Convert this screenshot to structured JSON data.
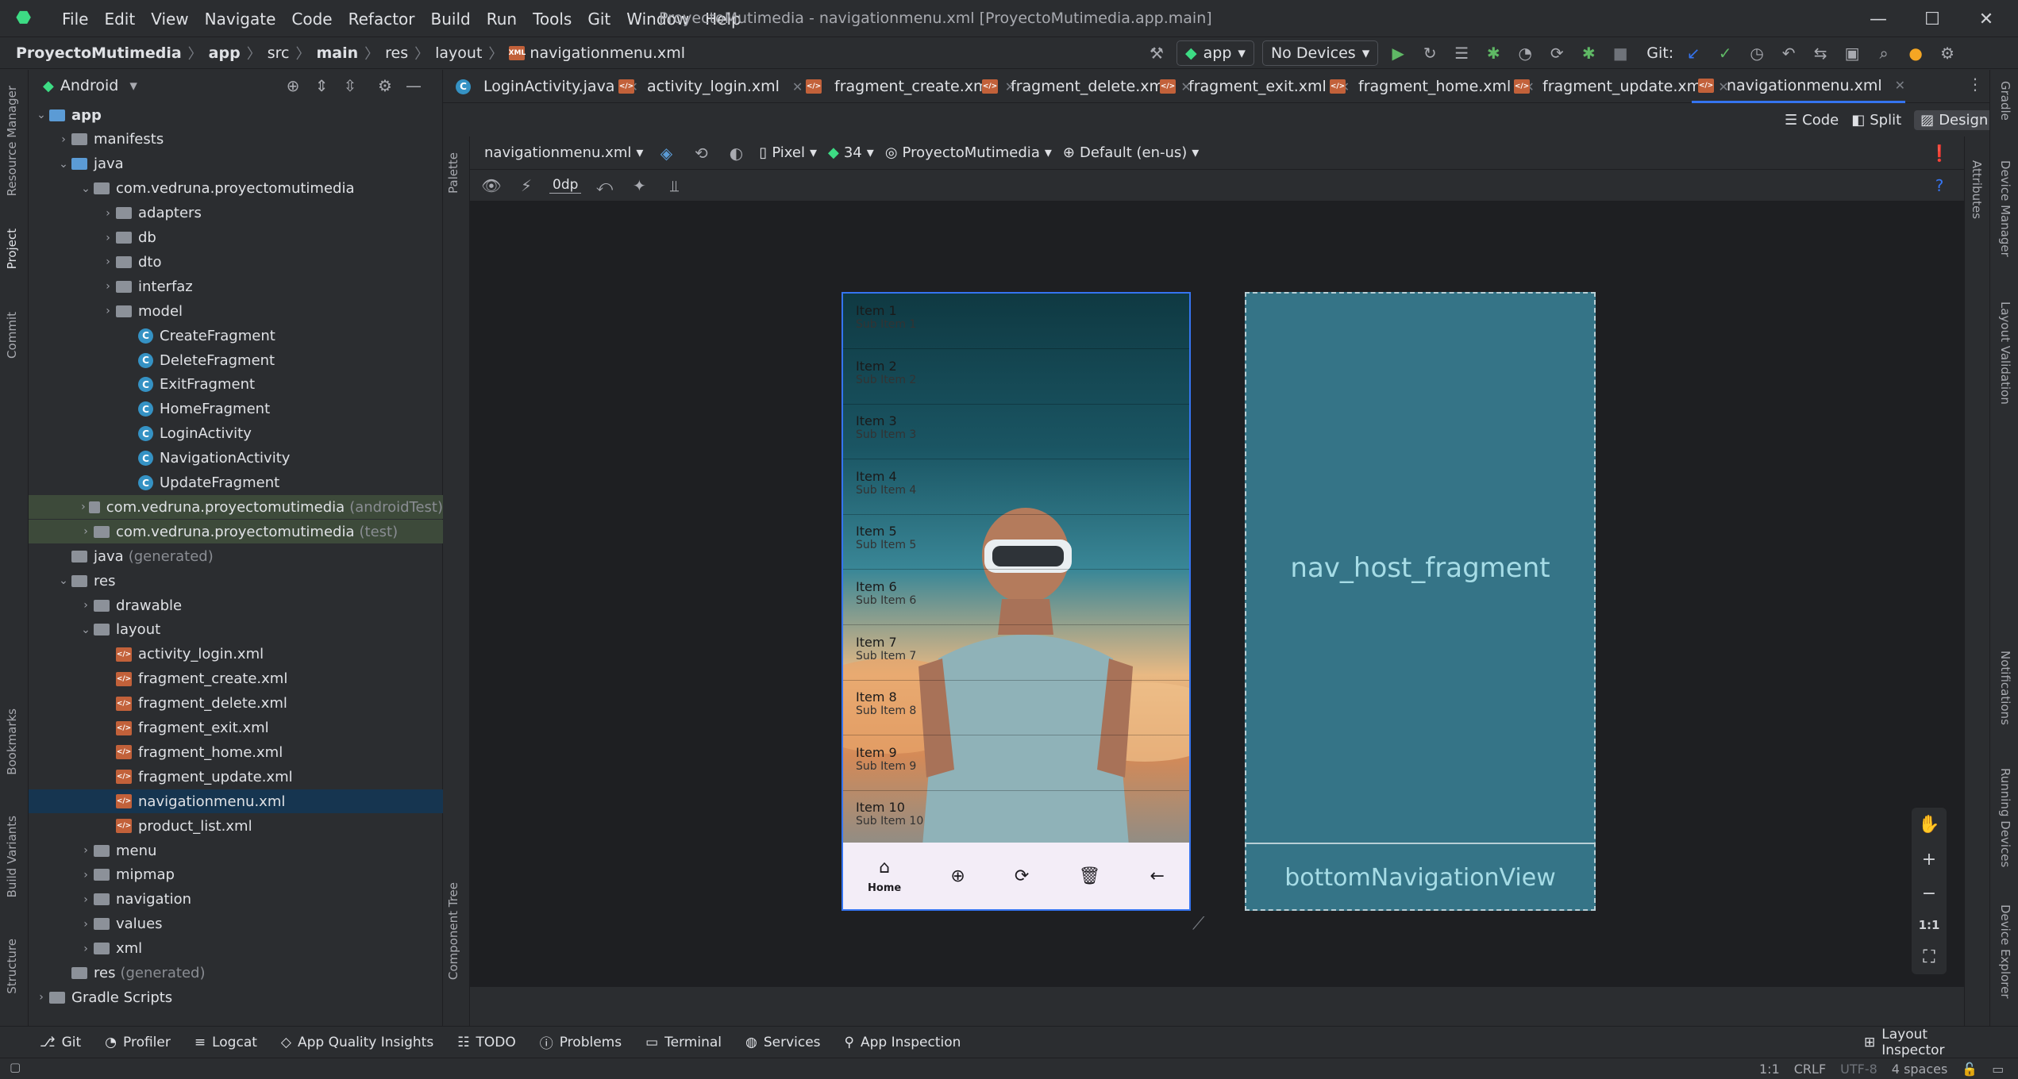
{
  "titlebar": {
    "menu": [
      "File",
      "Edit",
      "View",
      "Navigate",
      "Code",
      "Refactor",
      "Build",
      "Run",
      "Tools",
      "Git",
      "Window",
      "Help"
    ],
    "title": "ProyectoMutimedia - navigationmenu.xml [ProyectoMutimedia.app.main]"
  },
  "navbar": {
    "crumbs": [
      "ProyectoMutimedia",
      "app",
      "src",
      "main",
      "res",
      "layout",
      "navigationmenu.xml"
    ],
    "run_config": "app",
    "device": "No Devices",
    "git_label": "Git:"
  },
  "project": {
    "view_label": "Android",
    "tree": [
      {
        "label": "app",
        "level": 0,
        "icon": "module",
        "open": true,
        "bold": true
      },
      {
        "label": "manifests",
        "level": 1,
        "icon": "folder",
        "open": false
      },
      {
        "label": "java",
        "level": 1,
        "icon": "folder-blue",
        "open": true
      },
      {
        "label": "com.vedruna.proyectomutimedia",
        "level": 2,
        "icon": "package",
        "open": true
      },
      {
        "label": "adapters",
        "level": 3,
        "icon": "package",
        "open": false
      },
      {
        "label": "db",
        "level": 3,
        "icon": "package",
        "open": false
      },
      {
        "label": "dto",
        "level": 3,
        "icon": "package",
        "open": false
      },
      {
        "label": "interfaz",
        "level": 3,
        "icon": "package",
        "open": false
      },
      {
        "label": "model",
        "level": 3,
        "icon": "package",
        "open": false
      },
      {
        "label": "CreateFragment",
        "level": 4,
        "icon": "class"
      },
      {
        "label": "DeleteFragment",
        "level": 4,
        "icon": "class"
      },
      {
        "label": "ExitFragment",
        "level": 4,
        "icon": "class"
      },
      {
        "label": "HomeFragment",
        "level": 4,
        "icon": "class"
      },
      {
        "label": "LoginActivity",
        "level": 4,
        "icon": "class"
      },
      {
        "label": "NavigationActivity",
        "level": 4,
        "icon": "class"
      },
      {
        "label": "UpdateFragment",
        "level": 4,
        "icon": "class"
      },
      {
        "label": "com.vedruna.proyectomutimedia",
        "suffix": "(androidTest)",
        "level": 2,
        "icon": "package",
        "open": false,
        "hl": true
      },
      {
        "label": "com.vedruna.proyectomutimedia",
        "suffix": "(test)",
        "level": 2,
        "icon": "package",
        "open": false,
        "hl": true
      },
      {
        "label": "java",
        "suffix": "(generated)",
        "level": 1,
        "icon": "folder-gen"
      },
      {
        "label": "res",
        "level": 1,
        "icon": "folder-res",
        "open": true
      },
      {
        "label": "drawable",
        "level": 2,
        "icon": "folder",
        "open": false
      },
      {
        "label": "layout",
        "level": 2,
        "icon": "folder",
        "open": true
      },
      {
        "label": "activity_login.xml",
        "level": 3,
        "icon": "xml"
      },
      {
        "label": "fragment_create.xml",
        "level": 3,
        "icon": "xml"
      },
      {
        "label": "fragment_delete.xml",
        "level": 3,
        "icon": "xml"
      },
      {
        "label": "fragment_exit.xml",
        "level": 3,
        "icon": "xml"
      },
      {
        "label": "fragment_home.xml",
        "level": 3,
        "icon": "xml"
      },
      {
        "label": "fragment_update.xml",
        "level": 3,
        "icon": "xml"
      },
      {
        "label": "navigationmenu.xml",
        "level": 3,
        "icon": "xml",
        "selected": true
      },
      {
        "label": "product_list.xml",
        "level": 3,
        "icon": "xml"
      },
      {
        "label": "menu",
        "level": 2,
        "icon": "folder",
        "open": false
      },
      {
        "label": "mipmap",
        "level": 2,
        "icon": "folder",
        "open": false
      },
      {
        "label": "navigation",
        "level": 2,
        "icon": "folder",
        "open": false
      },
      {
        "label": "values",
        "level": 2,
        "icon": "folder",
        "open": false
      },
      {
        "label": "xml",
        "level": 2,
        "icon": "folder",
        "open": false
      },
      {
        "label": "res",
        "suffix": "(generated)",
        "level": 1,
        "icon": "folder-res"
      },
      {
        "label": "Gradle Scripts",
        "level": 0,
        "icon": "gradle",
        "open": false
      }
    ]
  },
  "left_strip": [
    "Resource Manager",
    "Project",
    "Commit",
    "Bookmarks",
    "Build Variants",
    "Structure"
  ],
  "right_strip": [
    "Gradle",
    "Device Manager",
    "Layout Validation",
    "Notifications",
    "Running Devices",
    "Device Explorer"
  ],
  "tabs": [
    "LoginActivity.java",
    "activity_login.xml",
    "fragment_create.xml",
    "fragment_delete.xml",
    "fragment_exit.xml",
    "fragment_home.xml",
    "fragment_update.xml",
    "navigationmenu.xml"
  ],
  "design_modes": [
    "Code",
    "Split",
    "Design"
  ],
  "toolbar1": {
    "file": "navigationmenu.xml",
    "device": "Pixel",
    "api": "34",
    "theme": "ProyectoMutimedia",
    "locale": "Default (en-us)"
  },
  "toolbar2": {
    "margin": "0dp"
  },
  "palette_label": "Palette",
  "component_tree_label": "Component Tree",
  "attributes_label": "Attributes",
  "preview": {
    "items": [
      {
        "title": "Item 1",
        "sub": "Sub Item 1"
      },
      {
        "title": "Item 2",
        "sub": "Sub Item 2"
      },
      {
        "title": "Item 3",
        "sub": "Sub Item 3"
      },
      {
        "title": "Item 4",
        "sub": "Sub Item 4"
      },
      {
        "title": "Item 5",
        "sub": "Sub Item 5"
      },
      {
        "title": "Item 6",
        "sub": "Sub Item 6"
      },
      {
        "title": "Item 7",
        "sub": "Sub Item 7"
      },
      {
        "title": "Item 8",
        "sub": "Sub Item 8"
      },
      {
        "title": "Item 9",
        "sub": "Sub Item 9"
      },
      {
        "title": "Item 10",
        "sub": "Sub Item 10"
      }
    ],
    "bottom_nav_home": "Home"
  },
  "blueprint": {
    "host": "nav_host_fragment",
    "nav": "bottomNavigationView"
  },
  "zoom": {
    "ratio": "1:1"
  },
  "statusbar": [
    "Git",
    "Profiler",
    "Logcat",
    "App Quality Insights",
    "TODO",
    "Problems",
    "Terminal",
    "Services",
    "App Inspection"
  ],
  "layout_inspector": "Layout Inspector",
  "bottom": {
    "pos": "1:1",
    "eol": "CRLF",
    "enc": "UTF-8",
    "indent": "4 spaces"
  }
}
